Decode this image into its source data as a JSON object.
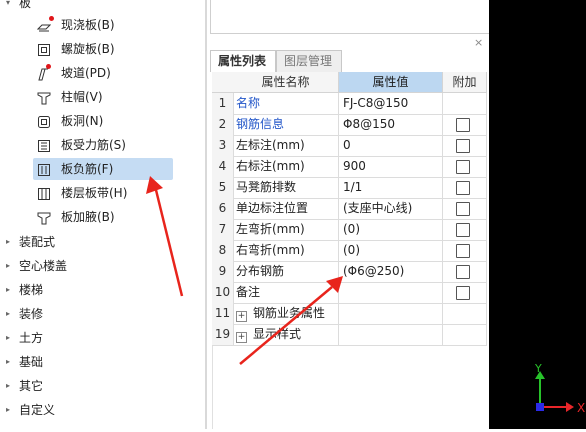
{
  "tree": {
    "top_label": "板",
    "children": [
      {
        "label": "现浇板(B)",
        "icon": "slab-icon",
        "dot": true
      },
      {
        "label": "螺旋板(B)",
        "icon": "spiral-slab-icon",
        "dot": false
      },
      {
        "label": "坡道(PD)",
        "icon": "ramp-icon",
        "dot": true
      },
      {
        "label": "柱帽(V)",
        "icon": "column-cap-icon",
        "dot": false
      },
      {
        "label": "板洞(N)",
        "icon": "slab-hole-icon",
        "dot": false
      },
      {
        "label": "板受力筋(S)",
        "icon": "slab-rebar-icon",
        "dot": false
      },
      {
        "label": "板负筋(F)",
        "icon": "negative-rebar-icon",
        "dot": false,
        "selected": true
      },
      {
        "label": "楼层板带(H)",
        "icon": "floor-strip-icon",
        "dot": false
      },
      {
        "label": "板加腋(B)",
        "icon": "slab-haunch-icon",
        "dot": false
      }
    ],
    "groups": [
      "装配式",
      "空心楼盖",
      "楼梯",
      "装修",
      "土方",
      "基础",
      "其它",
      "自定义"
    ]
  },
  "panel": {
    "close_glyph": "×",
    "tabs": [
      "属性列表",
      "图层管理"
    ],
    "columns": {
      "name": "属性名称",
      "value": "属性值",
      "extra": "附加"
    },
    "rows": [
      {
        "num": "1",
        "name": "名称",
        "value": "FJ-C8@150",
        "blue": true,
        "checkbox": false
      },
      {
        "num": "2",
        "name": "钢筋信息",
        "value": "Φ8@150",
        "blue": true,
        "checkbox": true
      },
      {
        "num": "3",
        "name": "左标注(mm)",
        "value": "0",
        "blue": false,
        "checkbox": true
      },
      {
        "num": "4",
        "name": "右标注(mm)",
        "value": "900",
        "blue": false,
        "checkbox": true
      },
      {
        "num": "5",
        "name": "马凳筋排数",
        "value": "1/1",
        "blue": false,
        "checkbox": true
      },
      {
        "num": "6",
        "name": "单边标注位置",
        "value": "(支座中心线)",
        "blue": false,
        "checkbox": true
      },
      {
        "num": "7",
        "name": "左弯折(mm)",
        "value": "(0)",
        "blue": false,
        "checkbox": true
      },
      {
        "num": "8",
        "name": "右弯折(mm)",
        "value": "(0)",
        "blue": false,
        "checkbox": true
      },
      {
        "num": "9",
        "name": "分布钢筋",
        "value": "(Φ6@250)",
        "blue": false,
        "checkbox": true
      },
      {
        "num": "10",
        "name": "备注",
        "value": "",
        "blue": false,
        "checkbox": true
      },
      {
        "num": "11",
        "name": "钢筋业务属性",
        "value": "",
        "blue": false,
        "checkbox": false,
        "expander": "+"
      },
      {
        "num": "19",
        "name": "显示样式",
        "value": "",
        "blue": false,
        "checkbox": false,
        "expander": "+"
      }
    ]
  },
  "viewport": {
    "axis_x": "X",
    "axis_y": "Y",
    "colors": {
      "x": "#e8262a",
      "y": "#27c22a",
      "z": "#2a2ae8"
    }
  },
  "annotation_color": "#e8241c"
}
